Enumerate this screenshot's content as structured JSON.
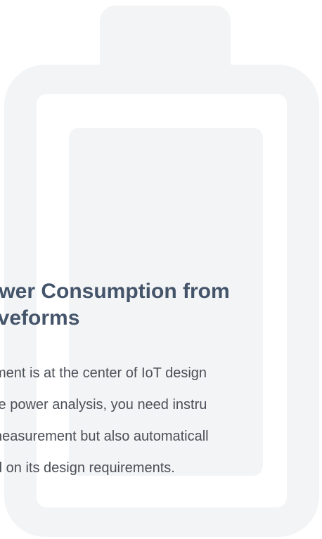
{
  "graphic": {
    "icon": "battery-icon",
    "color": "#f3f4f5"
  },
  "article": {
    "title_lines": [
      "ower Consumption from",
      "aveforms"
    ],
    "body_lines": [
      "ment is at the center of IoT design",
      "te power analysis, you need instru",
      "neasurement but also automaticall",
      "d on its design requirements."
    ]
  },
  "colors": {
    "title": "#44546a",
    "body": "#4a4f58"
  }
}
